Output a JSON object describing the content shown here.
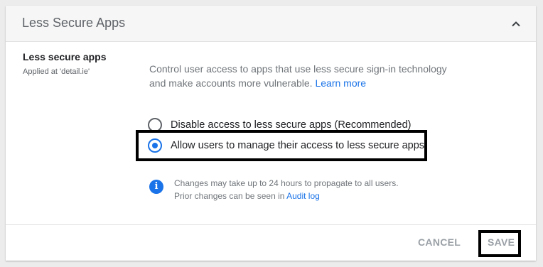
{
  "card": {
    "title": "Less Secure Apps",
    "collapse_icon": "chevron-up-icon"
  },
  "setting": {
    "label": "Less secure apps",
    "applied_at": "Applied at 'detail.ie'",
    "description": "Control user access to apps that use less secure sign-in technology and make accounts more vulnerable.",
    "learn_more": "Learn more"
  },
  "options": [
    {
      "label": "Disable access to less secure apps (Recommended)",
      "checked": false
    },
    {
      "label": "Allow users to manage their access to less secure apps",
      "checked": true
    }
  ],
  "info": {
    "icon": "info-icon",
    "line1": "Changes may take up to 24 hours to propagate to all users.",
    "line2": "Prior changes can be seen in",
    "audit_log": "Audit log"
  },
  "footer": {
    "cancel_label": "CANCEL",
    "save_label": "SAVE"
  },
  "colors": {
    "accent": "#1a73e8",
    "header_bg": "#f6f6f6",
    "disabled_text": "#9aa0a6"
  }
}
